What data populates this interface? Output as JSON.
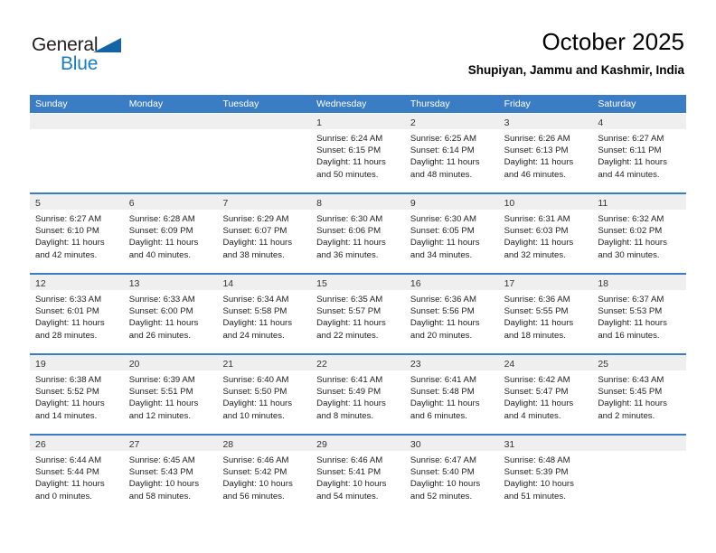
{
  "brand": {
    "name_part1": "General",
    "name_part2": "Blue",
    "accent_color": "#1a7dc4",
    "triangle_color": "#1464a5"
  },
  "header": {
    "title": "October 2025",
    "subtitle": "Shupiyan, Jammu and Kashmir, India"
  },
  "calendar": {
    "header_bg": "#3b7dc4",
    "day_band_bg": "#efefef",
    "weekday_headers": [
      "Sunday",
      "Monday",
      "Tuesday",
      "Wednesday",
      "Thursday",
      "Friday",
      "Saturday"
    ],
    "weeks": [
      [
        {
          "day": "",
          "sunrise": "",
          "sunset": "",
          "daylight_line1": "",
          "daylight_line2": ""
        },
        {
          "day": "",
          "sunrise": "",
          "sunset": "",
          "daylight_line1": "",
          "daylight_line2": ""
        },
        {
          "day": "",
          "sunrise": "",
          "sunset": "",
          "daylight_line1": "",
          "daylight_line2": ""
        },
        {
          "day": "1",
          "sunrise": "Sunrise: 6:24 AM",
          "sunset": "Sunset: 6:15 PM",
          "daylight_line1": "Daylight: 11 hours",
          "daylight_line2": "and 50 minutes."
        },
        {
          "day": "2",
          "sunrise": "Sunrise: 6:25 AM",
          "sunset": "Sunset: 6:14 PM",
          "daylight_line1": "Daylight: 11 hours",
          "daylight_line2": "and 48 minutes."
        },
        {
          "day": "3",
          "sunrise": "Sunrise: 6:26 AM",
          "sunset": "Sunset: 6:13 PM",
          "daylight_line1": "Daylight: 11 hours",
          "daylight_line2": "and 46 minutes."
        },
        {
          "day": "4",
          "sunrise": "Sunrise: 6:27 AM",
          "sunset": "Sunset: 6:11 PM",
          "daylight_line1": "Daylight: 11 hours",
          "daylight_line2": "and 44 minutes."
        }
      ],
      [
        {
          "day": "5",
          "sunrise": "Sunrise: 6:27 AM",
          "sunset": "Sunset: 6:10 PM",
          "daylight_line1": "Daylight: 11 hours",
          "daylight_line2": "and 42 minutes."
        },
        {
          "day": "6",
          "sunrise": "Sunrise: 6:28 AM",
          "sunset": "Sunset: 6:09 PM",
          "daylight_line1": "Daylight: 11 hours",
          "daylight_line2": "and 40 minutes."
        },
        {
          "day": "7",
          "sunrise": "Sunrise: 6:29 AM",
          "sunset": "Sunset: 6:07 PM",
          "daylight_line1": "Daylight: 11 hours",
          "daylight_line2": "and 38 minutes."
        },
        {
          "day": "8",
          "sunrise": "Sunrise: 6:30 AM",
          "sunset": "Sunset: 6:06 PM",
          "daylight_line1": "Daylight: 11 hours",
          "daylight_line2": "and 36 minutes."
        },
        {
          "day": "9",
          "sunrise": "Sunrise: 6:30 AM",
          "sunset": "Sunset: 6:05 PM",
          "daylight_line1": "Daylight: 11 hours",
          "daylight_line2": "and 34 minutes."
        },
        {
          "day": "10",
          "sunrise": "Sunrise: 6:31 AM",
          "sunset": "Sunset: 6:03 PM",
          "daylight_line1": "Daylight: 11 hours",
          "daylight_line2": "and 32 minutes."
        },
        {
          "day": "11",
          "sunrise": "Sunrise: 6:32 AM",
          "sunset": "Sunset: 6:02 PM",
          "daylight_line1": "Daylight: 11 hours",
          "daylight_line2": "and 30 minutes."
        }
      ],
      [
        {
          "day": "12",
          "sunrise": "Sunrise: 6:33 AM",
          "sunset": "Sunset: 6:01 PM",
          "daylight_line1": "Daylight: 11 hours",
          "daylight_line2": "and 28 minutes."
        },
        {
          "day": "13",
          "sunrise": "Sunrise: 6:33 AM",
          "sunset": "Sunset: 6:00 PM",
          "daylight_line1": "Daylight: 11 hours",
          "daylight_line2": "and 26 minutes."
        },
        {
          "day": "14",
          "sunrise": "Sunrise: 6:34 AM",
          "sunset": "Sunset: 5:58 PM",
          "daylight_line1": "Daylight: 11 hours",
          "daylight_line2": "and 24 minutes."
        },
        {
          "day": "15",
          "sunrise": "Sunrise: 6:35 AM",
          "sunset": "Sunset: 5:57 PM",
          "daylight_line1": "Daylight: 11 hours",
          "daylight_line2": "and 22 minutes."
        },
        {
          "day": "16",
          "sunrise": "Sunrise: 6:36 AM",
          "sunset": "Sunset: 5:56 PM",
          "daylight_line1": "Daylight: 11 hours",
          "daylight_line2": "and 20 minutes."
        },
        {
          "day": "17",
          "sunrise": "Sunrise: 6:36 AM",
          "sunset": "Sunset: 5:55 PM",
          "daylight_line1": "Daylight: 11 hours",
          "daylight_line2": "and 18 minutes."
        },
        {
          "day": "18",
          "sunrise": "Sunrise: 6:37 AM",
          "sunset": "Sunset: 5:53 PM",
          "daylight_line1": "Daylight: 11 hours",
          "daylight_line2": "and 16 minutes."
        }
      ],
      [
        {
          "day": "19",
          "sunrise": "Sunrise: 6:38 AM",
          "sunset": "Sunset: 5:52 PM",
          "daylight_line1": "Daylight: 11 hours",
          "daylight_line2": "and 14 minutes."
        },
        {
          "day": "20",
          "sunrise": "Sunrise: 6:39 AM",
          "sunset": "Sunset: 5:51 PM",
          "daylight_line1": "Daylight: 11 hours",
          "daylight_line2": "and 12 minutes."
        },
        {
          "day": "21",
          "sunrise": "Sunrise: 6:40 AM",
          "sunset": "Sunset: 5:50 PM",
          "daylight_line1": "Daylight: 11 hours",
          "daylight_line2": "and 10 minutes."
        },
        {
          "day": "22",
          "sunrise": "Sunrise: 6:41 AM",
          "sunset": "Sunset: 5:49 PM",
          "daylight_line1": "Daylight: 11 hours",
          "daylight_line2": "and 8 minutes."
        },
        {
          "day": "23",
          "sunrise": "Sunrise: 6:41 AM",
          "sunset": "Sunset: 5:48 PM",
          "daylight_line1": "Daylight: 11 hours",
          "daylight_line2": "and 6 minutes."
        },
        {
          "day": "24",
          "sunrise": "Sunrise: 6:42 AM",
          "sunset": "Sunset: 5:47 PM",
          "daylight_line1": "Daylight: 11 hours",
          "daylight_line2": "and 4 minutes."
        },
        {
          "day": "25",
          "sunrise": "Sunrise: 6:43 AM",
          "sunset": "Sunset: 5:45 PM",
          "daylight_line1": "Daylight: 11 hours",
          "daylight_line2": "and 2 minutes."
        }
      ],
      [
        {
          "day": "26",
          "sunrise": "Sunrise: 6:44 AM",
          "sunset": "Sunset: 5:44 PM",
          "daylight_line1": "Daylight: 11 hours",
          "daylight_line2": "and 0 minutes."
        },
        {
          "day": "27",
          "sunrise": "Sunrise: 6:45 AM",
          "sunset": "Sunset: 5:43 PM",
          "daylight_line1": "Daylight: 10 hours",
          "daylight_line2": "and 58 minutes."
        },
        {
          "day": "28",
          "sunrise": "Sunrise: 6:46 AM",
          "sunset": "Sunset: 5:42 PM",
          "daylight_line1": "Daylight: 10 hours",
          "daylight_line2": "and 56 minutes."
        },
        {
          "day": "29",
          "sunrise": "Sunrise: 6:46 AM",
          "sunset": "Sunset: 5:41 PM",
          "daylight_line1": "Daylight: 10 hours",
          "daylight_line2": "and 54 minutes."
        },
        {
          "day": "30",
          "sunrise": "Sunrise: 6:47 AM",
          "sunset": "Sunset: 5:40 PM",
          "daylight_line1": "Daylight: 10 hours",
          "daylight_line2": "and 52 minutes."
        },
        {
          "day": "31",
          "sunrise": "Sunrise: 6:48 AM",
          "sunset": "Sunset: 5:39 PM",
          "daylight_line1": "Daylight: 10 hours",
          "daylight_line2": "and 51 minutes."
        },
        {
          "day": "",
          "sunrise": "",
          "sunset": "",
          "daylight_line1": "",
          "daylight_line2": ""
        }
      ]
    ]
  }
}
